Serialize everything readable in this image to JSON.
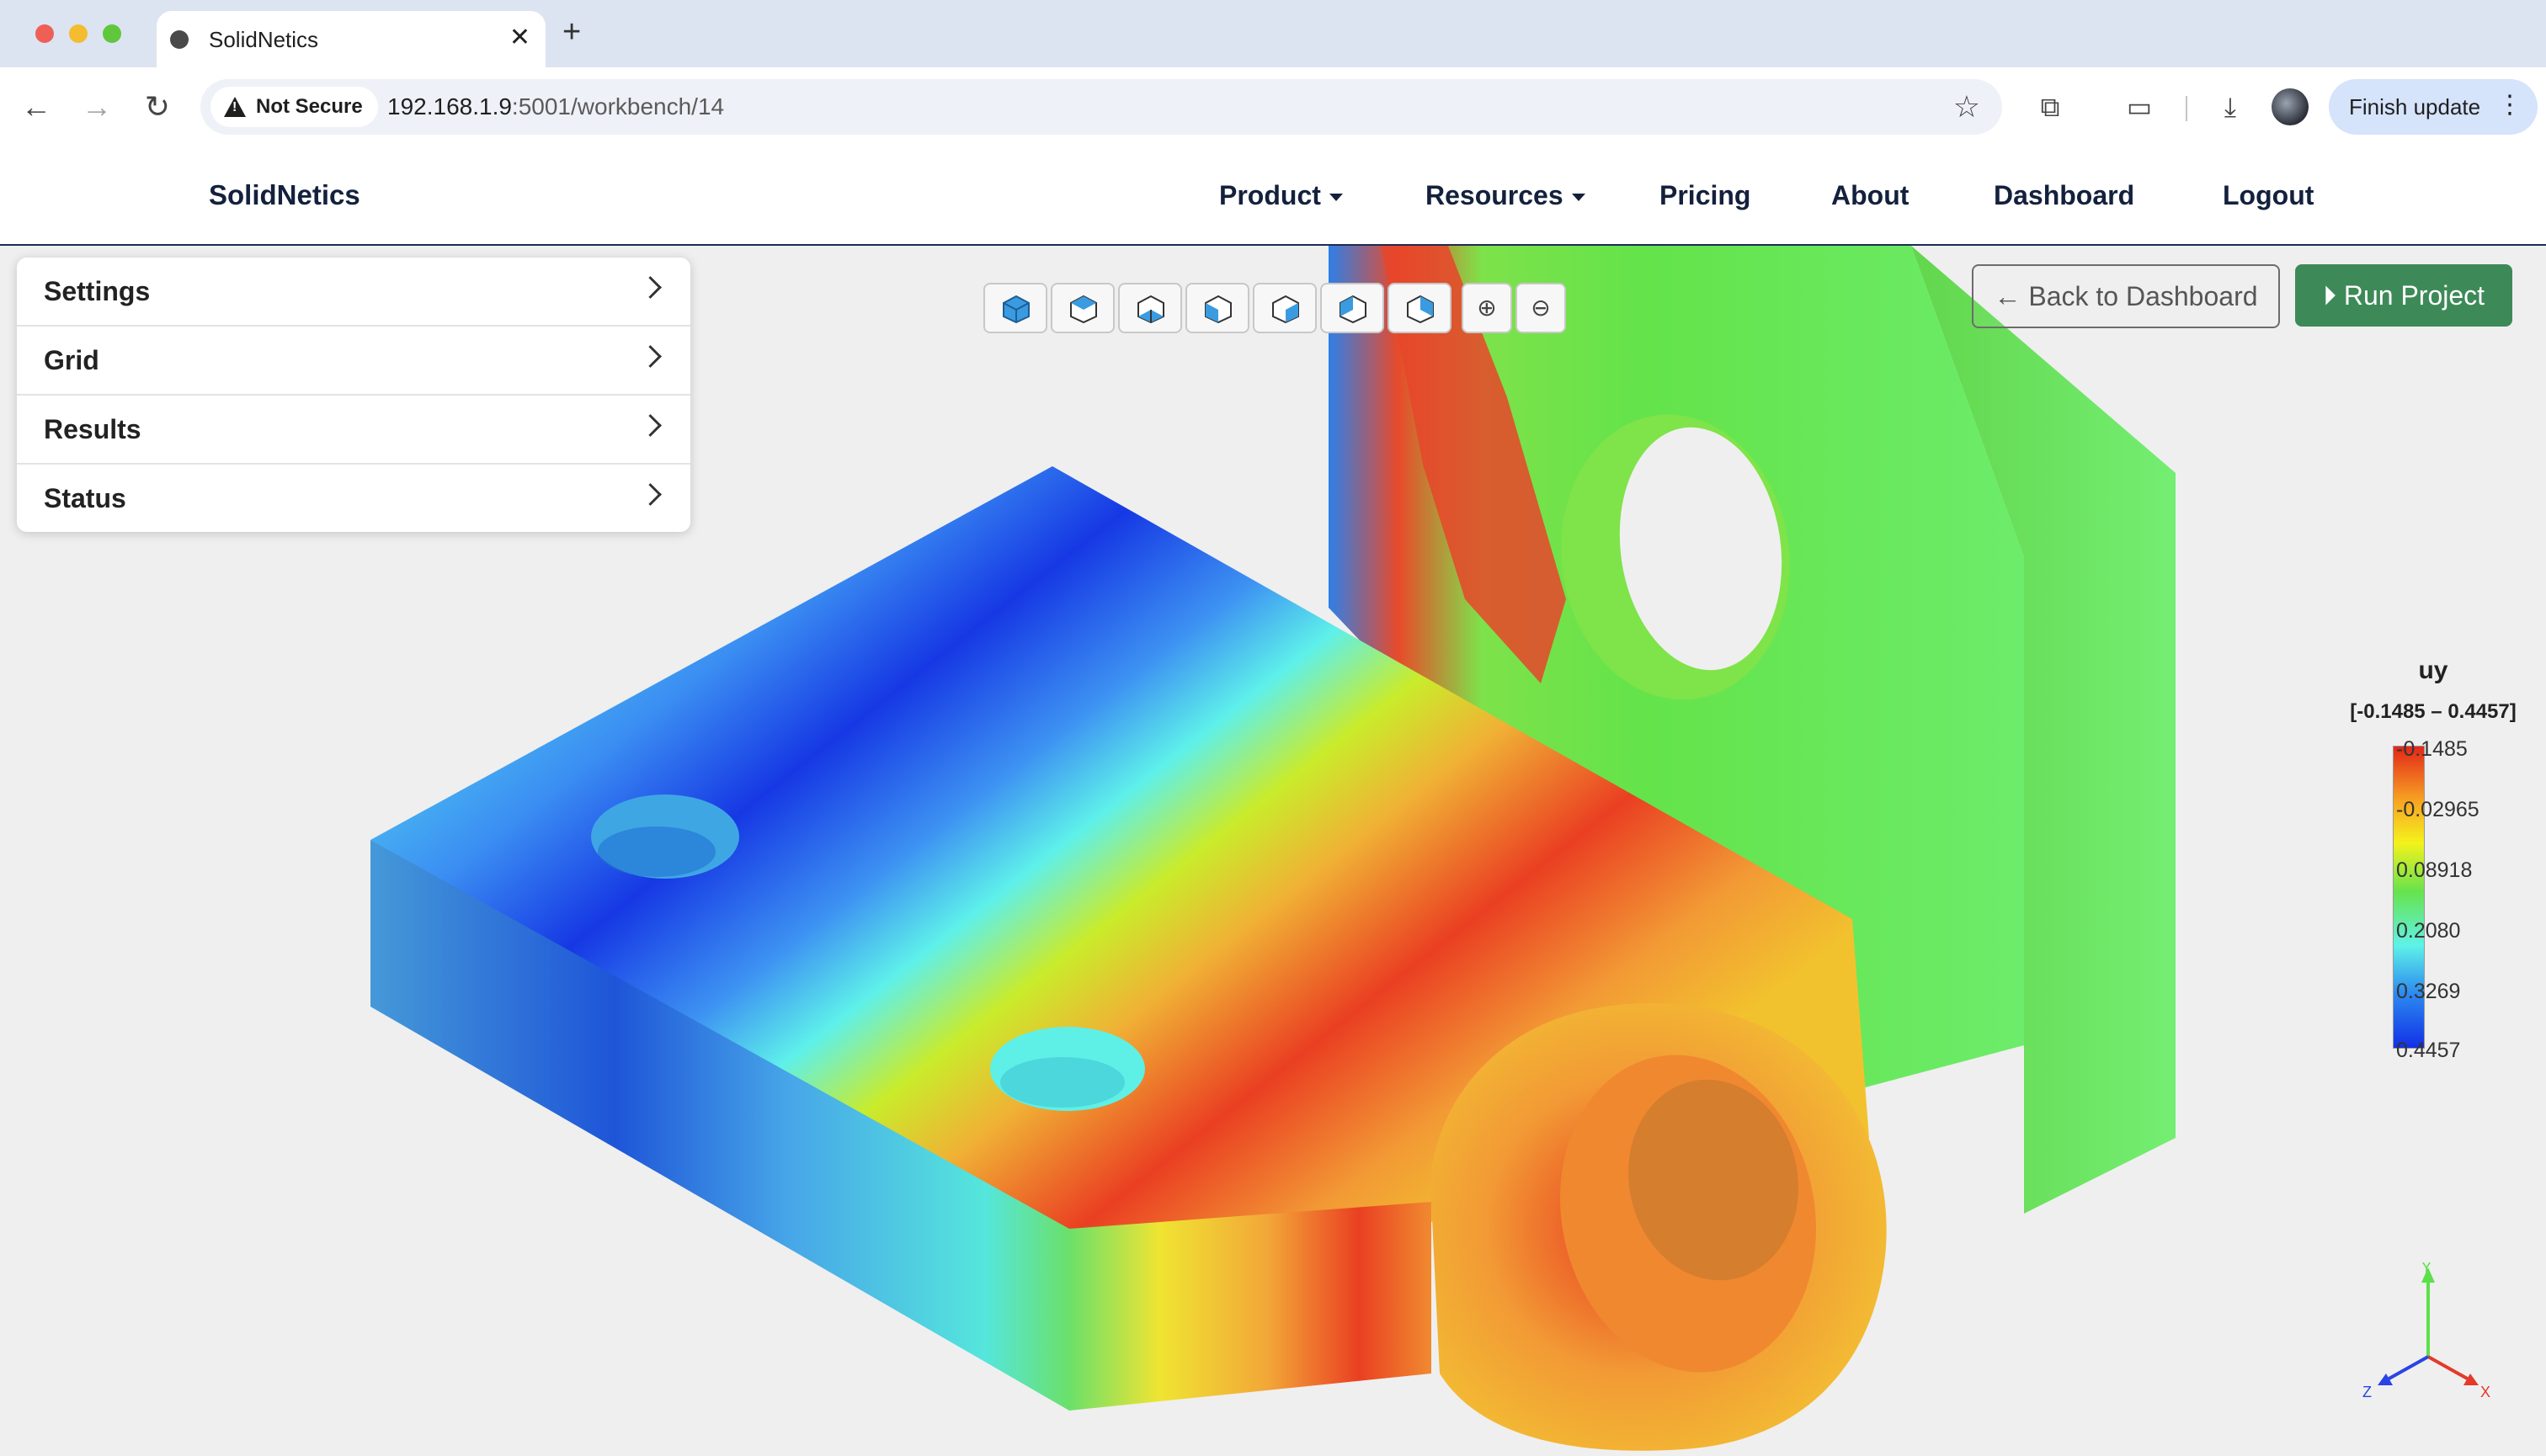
{
  "browser": {
    "tab_title": "SolidNetics",
    "security_label": "Not Secure",
    "url_host": "192.168.1.9",
    "url_rest": ":5001/workbench/14",
    "update_button": "Finish update"
  },
  "site": {
    "brand": "SolidNetics",
    "nav": {
      "product": "Product",
      "resources": "Resources",
      "pricing": "Pricing",
      "about": "About",
      "dashboard": "Dashboard",
      "logout": "Logout"
    }
  },
  "panel": {
    "items": [
      {
        "label": "Settings"
      },
      {
        "label": "Grid"
      },
      {
        "label": "Results"
      },
      {
        "label": "Status"
      }
    ]
  },
  "actions": {
    "back": "Back to Dashboard",
    "run": "Run Project"
  },
  "legend": {
    "title": "uy",
    "range": "[-0.1485 – 0.4457]",
    "ticks": [
      "-0.1485",
      "-0.02965",
      "0.08918",
      "0.2080",
      "0.3269",
      "0.4457"
    ],
    "colors": {
      "max": "#e32619",
      "min": "#1230e6"
    }
  },
  "axes": {
    "x": "X",
    "y": "Y",
    "z": "Z"
  }
}
